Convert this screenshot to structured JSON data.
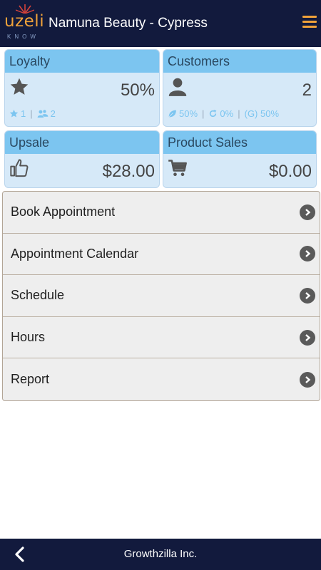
{
  "header": {
    "logo_text": "uzeli",
    "logo_sub": "KNOW",
    "title": "Namuna Beauty - Cypress"
  },
  "cards": {
    "loyalty": {
      "title": "Loyalty",
      "value": "50%",
      "stat1": "1",
      "stat2": "2"
    },
    "customers": {
      "title": "Customers",
      "value": "2",
      "stat1": "50%",
      "stat2": "0%",
      "stat3": "(G) 50%"
    },
    "upsale": {
      "title": "Upsale",
      "value": "$28.00"
    },
    "product_sales": {
      "title": "Product Sales",
      "value": "$0.00"
    }
  },
  "menu": [
    {
      "label": "Book Appointment"
    },
    {
      "label": "Appointment Calendar"
    },
    {
      "label": "Schedule"
    },
    {
      "label": "Hours"
    },
    {
      "label": "Report"
    }
  ],
  "footer": {
    "company": "Growthzilla Inc."
  },
  "colors": {
    "nav_bg": "#121a3d",
    "accent": "#f0a23a",
    "card_head": "#7cc5f0",
    "card_body": "#d6e9f8"
  }
}
